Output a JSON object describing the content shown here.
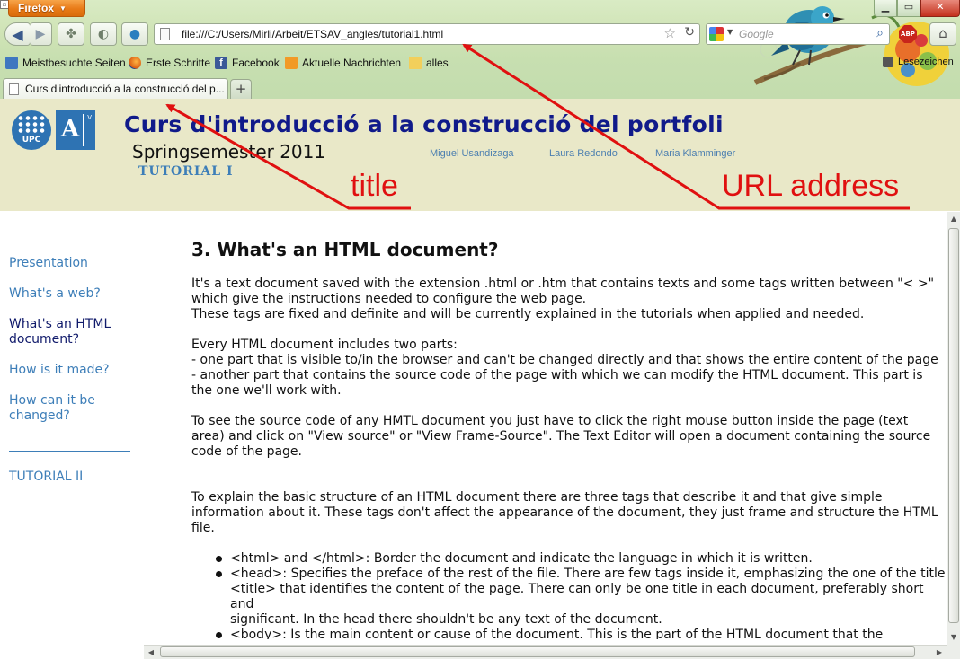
{
  "browser": {
    "menu_button": "Firefox",
    "url": "file:///C:/Users/Mirli/Arbeit/ETSAV_angles/tutorial1.html",
    "search_placeholder": "Google",
    "bookmarks": [
      "Meistbesuchte Seiten",
      "Erste Schritte",
      "Facebook",
      "Aktuelle Nachrichten",
      "alles"
    ],
    "bookmarks_right": "Lesezeichen",
    "tab_title": "Curs d'introducció a la construcció del p...",
    "new_tab_symbol": "+"
  },
  "header": {
    "logo_upc_label": "UPC",
    "site_title": "Curs d'introducció a la construcció del portfoli",
    "semester": "Springsemester 2011",
    "tutorial": "TUTORIAL I",
    "authors": [
      "Miguel Usandizaga",
      "Laura Redondo",
      "Maria Klamminger"
    ]
  },
  "sidebar": {
    "items": [
      "Presentation",
      "What's a web?",
      "What's an HTML\ndocument?",
      "How is it made?",
      "How can it be\nchanged?"
    ],
    "active_index": 2,
    "next_tutorial": "TUTORIAL II"
  },
  "content": {
    "heading": "3. What's an HTML document?",
    "p1": "It's a text document saved with the extension .html or .htm that contains texts and some tags written between \"< >\"\nwhich give the instructions needed to configure the web page.\nThese tags are fixed and definite and will be currently explained in the tutorials when applied and needed.",
    "p2": "Every HTML document includes two parts:\n- one part that is visible to/in the browser and can't be changed directly and that shows the entire content of the page\n- another part that contains the source code of the page with which we can modify the HTML document. This part is\nthe one we'll work with.",
    "p3": "To see the source code of any HMTL document you just have to click the right mouse button inside the page (text\narea) and click on \"View source\" or \"View Frame-Source\". The Text Editor will open a document containing the source\ncode of the page.",
    "p4": "To explain the basic structure of an HTML document there are three tags that describe it and that give simple\ninformation about it. These tags don't affect the appearance of the document, they just frame and structure the HTML\nfile.",
    "list": [
      "<html> and </html>: Border the document and indicate the language in which it is written.",
      "<head>: Specifies the preface of the rest of the file. There are few tags inside it, emphasizing the one of the title\n<title> that identifies the content of the page. There can only be one title in each document, preferably short and\nsignificant. In the head there shouldn't be any text of the document.",
      "<body>: Is the main content or cause of the document. This is the part of the HTML document that the\ncomputer shows."
    ]
  },
  "annotations": {
    "title_label": "title",
    "url_label": "URL address",
    "color": "#e01010"
  }
}
